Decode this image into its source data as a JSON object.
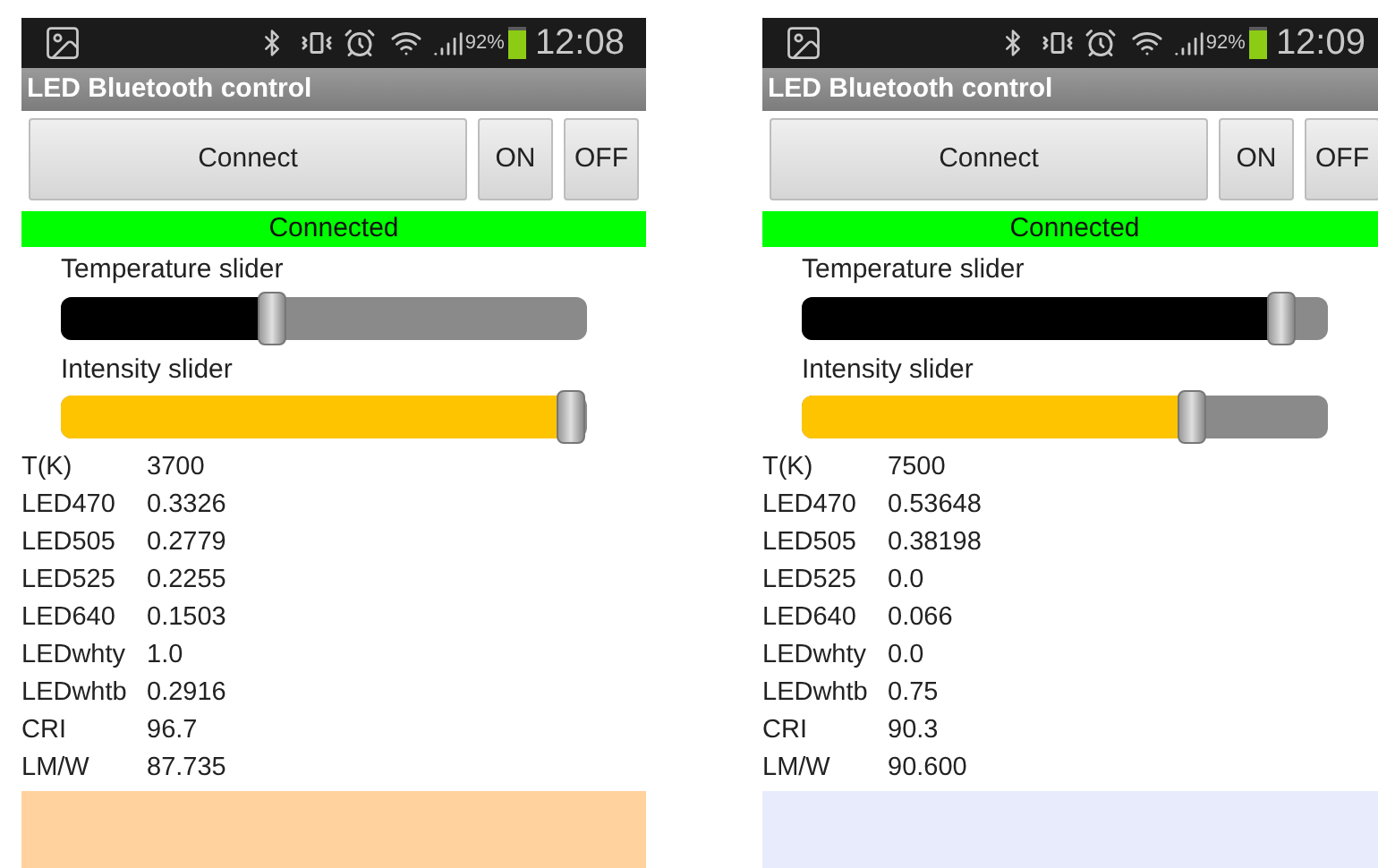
{
  "screens": [
    {
      "status_bar": {
        "battery": "92%",
        "time": "12:08"
      },
      "title": "LED Bluetooth control",
      "buttons": [
        "Connect",
        "ON",
        "OFF"
      ],
      "connection_status": "Connected",
      "sliders": [
        {
          "label": "Temperature slider",
          "level": 0.4,
          "color": "#000000"
        },
        {
          "label": "Intensity slider",
          "level": 0.97,
          "color": "#ffc400"
        }
      ],
      "readings": [
        {
          "name": "T(K)",
          "value": "3700"
        },
        {
          "name": "LED470",
          "value": "0.3326"
        },
        {
          "name": "LED505",
          "value": "0.2779"
        },
        {
          "name": "LED525",
          "value": "0.2255"
        },
        {
          "name": "LED640",
          "value": "0.1503"
        },
        {
          "name": "LEDwhty",
          "value": "1.0"
        },
        {
          "name": "LEDwhtb",
          "value": "0.2916"
        },
        {
          "name": "CRI",
          "value": "96.7"
        },
        {
          "name": "LM/W",
          "value": "87.735"
        }
      ],
      "swatch": {
        "color": "#ffd29e"
      }
    },
    {
      "status_bar": {
        "battery": "92%",
        "time": "12:09"
      },
      "title": "LED Bluetooth control",
      "buttons": [
        "Connect",
        "ON",
        "OFF"
      ],
      "connection_status": "Connected",
      "sliders": [
        {
          "label": "Temperature slider",
          "level": 0.91,
          "color": "#000000"
        },
        {
          "label": "Intensity slider",
          "level": 0.74,
          "color": "#ffc400"
        }
      ],
      "readings": [
        {
          "name": "T(K)",
          "value": "7500"
        },
        {
          "name": "LED470",
          "value": "0.53648"
        },
        {
          "name": "LED505",
          "value": "0.38198"
        },
        {
          "name": "LED525",
          "value": "0.0"
        },
        {
          "name": "LED640",
          "value": "0.066"
        },
        {
          "name": "LEDwhty",
          "value": "0.0"
        },
        {
          "name": "LEDwhtb",
          "value": "0.75"
        },
        {
          "name": "CRI",
          "value": "90.3"
        },
        {
          "name": "LM/W",
          "value": "90.600"
        }
      ],
      "swatch": {
        "color": "#e8ebfb"
      }
    }
  ]
}
